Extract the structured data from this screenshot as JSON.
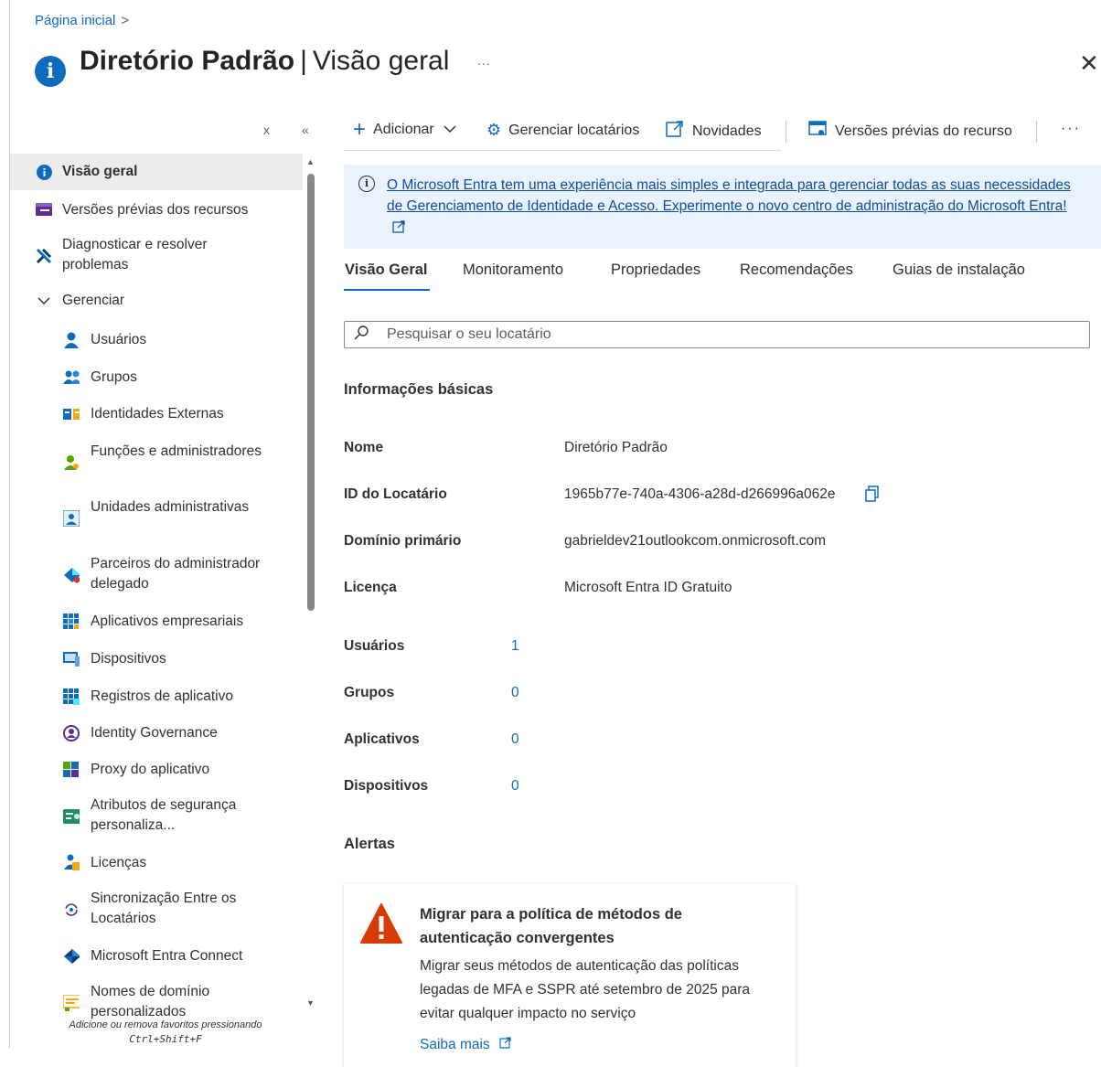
{
  "breadcrumb": {
    "home": "Página inicial",
    "separator": ">"
  },
  "header": {
    "title_bold": "Diretório Padrão",
    "separator": "|",
    "title_light": "Visão geral",
    "more": "...",
    "close": "✕"
  },
  "sidebar": {
    "close_ctl": "x",
    "collapse_ctl": "«",
    "items": [
      {
        "label": "Visão geral",
        "icon": "info-icon"
      },
      {
        "label": "Versões prévias dos recursos",
        "icon": "preview-features-icon"
      },
      {
        "label": "Diagnosticar e resolver problemas",
        "icon": "wrench-icon"
      },
      {
        "label": "Gerenciar",
        "icon": "chevron-down-icon"
      },
      {
        "label": "Usuários",
        "icon": "user-icon"
      },
      {
        "label": "Grupos",
        "icon": "group-icon"
      },
      {
        "label": "Identidades Externas",
        "icon": "external-identities-icon"
      },
      {
        "label": "Funções e administradores",
        "icon": "roles-icon"
      },
      {
        "label": "Unidades administrativas",
        "icon": "admin-units-icon"
      },
      {
        "label": "Parceiros do administrador delegado",
        "icon": "partners-icon"
      },
      {
        "label": "Aplicativos empresariais",
        "icon": "enterprise-apps-icon"
      },
      {
        "label": "Dispositivos",
        "icon": "devices-icon"
      },
      {
        "label": "Registros de aplicativo",
        "icon": "app-registrations-icon"
      },
      {
        "label": "Identity Governance",
        "icon": "identity-governance-icon"
      },
      {
        "label": "Proxy do aplicativo",
        "icon": "app-proxy-icon"
      },
      {
        "label": "Atributos de segurança personaliza...",
        "icon": "security-attributes-icon"
      },
      {
        "label": "Licenças",
        "icon": "licenses-icon"
      },
      {
        "label": "Sincronização Entre os Locatários",
        "icon": "sync-icon"
      },
      {
        "label": "Microsoft Entra Connect",
        "icon": "entra-connect-icon"
      },
      {
        "label": "Nomes de domínio personalizados",
        "icon": "domain-names-icon"
      }
    ],
    "footer_line1": "Adicione ou remova favoritos pressionando",
    "footer_line2": "Ctrl+Shift+F"
  },
  "toolbar": {
    "add": "Adicionar",
    "manage_tenants": "Gerenciar locatários",
    "whats_new": "Novidades",
    "preview_features": "Versões prévias do recurso",
    "more": "···"
  },
  "banner": {
    "text": "O Microsoft Entra tem uma experiência mais simples e integrada para gerenciar todas as suas necessidades de Gerenciamento de Identidade e Acesso. Experimente o novo centro de administração do Microsoft Entra!"
  },
  "tabs": [
    "Visão Geral",
    "Monitoramento",
    "Propriedades",
    "Recomendações",
    "Guias de instalação"
  ],
  "search": {
    "placeholder": "Pesquisar o seu locatário",
    "value": ""
  },
  "basic_info": {
    "heading": "Informações básicas",
    "fields": [
      {
        "label": "Nome",
        "value": "Diretório Padrão"
      },
      {
        "label": "ID do Locatário",
        "value": "1965b77e-740a-4306-a28d-d266996a062e"
      },
      {
        "label": "Domínio primário",
        "value": "gabrieldev21outlookcom.onmicrosoft.com"
      },
      {
        "label": "Licença",
        "value": "Microsoft Entra ID Gratuito"
      }
    ],
    "counts": [
      {
        "label": "Usuários",
        "value": "1"
      },
      {
        "label": "Grupos",
        "value": "0"
      },
      {
        "label": "Aplicativos",
        "value": "0"
      },
      {
        "label": "Dispositivos",
        "value": "0"
      }
    ]
  },
  "alerts": {
    "heading": "Alertas",
    "card": {
      "title": "Migrar para a política de métodos de autenticação convergentes",
      "description": "Migrar seus métodos de autenticação das políticas legadas de MFA e SSPR até setembro de 2025 para evitar qualquer impacto no serviço",
      "link": "Saiba mais"
    }
  },
  "colors": {
    "accent": "#0f6cbd",
    "banner_bg": "#eaf3fd",
    "warning": "#d83b01",
    "active_item_bg": "#ececec"
  }
}
